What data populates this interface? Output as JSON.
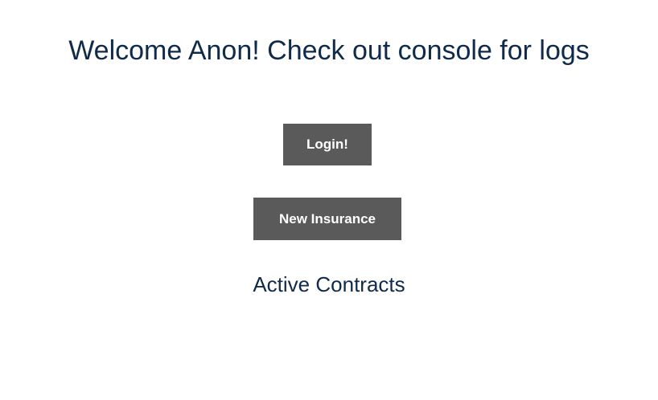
{
  "header": {
    "title": "Welcome Anon! Check out console for logs"
  },
  "actions": {
    "login_label": "Login!",
    "new_insurance_label": "New Insurance"
  },
  "contracts": {
    "heading": "Active Contracts"
  },
  "colors": {
    "text": "#0f2a4a",
    "button_bg": "#5a5a5a",
    "button_text": "#ffffff"
  }
}
